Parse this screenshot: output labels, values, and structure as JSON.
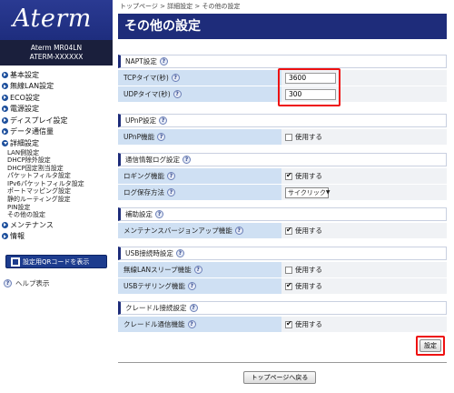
{
  "brand": {
    "logo": "Aterm",
    "model_line1": "Aterm MR04LN",
    "model_line2": "ATERM-XXXXXX"
  },
  "sidebar": {
    "menu": [
      {
        "label": "基本設定",
        "open": false
      },
      {
        "label": "無線LAN設定",
        "open": false
      },
      {
        "label": "ECO設定",
        "open": false
      },
      {
        "label": "電源設定",
        "open": false
      },
      {
        "label": "ディスプレイ設定",
        "open": false
      },
      {
        "label": "データ通信量",
        "open": false
      },
      {
        "label": "詳細設定",
        "open": true
      }
    ],
    "submenu": [
      "LAN側設定",
      "DHCP除外設定",
      "DHCP固定割当設定",
      "パケットフィルタ設定",
      "IPv6パケットフィルタ設定",
      "ポートマッピング設定",
      "静的ルーティング設定",
      "PIN設定",
      "その他の設定"
    ],
    "menu_after": [
      {
        "label": "メンテナンス",
        "open": false
      },
      {
        "label": "情報",
        "open": false
      }
    ],
    "qr_button": "設定用QRコードを表示",
    "help_link": "ヘルプ表示"
  },
  "breadcrumb": "トップページ > 詳細設定 > その他の設定",
  "page_title": "その他の設定",
  "help_glyph": "?",
  "sections": {
    "napt": {
      "title": "NAPT設定",
      "tcp_label": "TCPタイマ(秒)",
      "tcp_value": "3600",
      "udp_label": "UDPタイマ(秒)",
      "udp_value": "300"
    },
    "upnp": {
      "title": "UPnP設定",
      "label": "UPnP機能",
      "check_label": "使用する",
      "checked": false
    },
    "log": {
      "title": "通信情報ログ設定",
      "logging_label": "ロギング機能",
      "logging_check": "使用する",
      "logging_checked": true,
      "save_label": "ログ保存方法",
      "save_value": "サイクリック"
    },
    "aux": {
      "title": "補助設定",
      "label": "メンテナンスバージョンアップ機能",
      "check_label": "使用する",
      "checked": true
    },
    "usb": {
      "title": "USB接続時設定",
      "sleep_label": "無線LANスリープ機能",
      "sleep_check": "使用する",
      "sleep_checked": false,
      "tether_label": "USBテザリング機能",
      "tether_check": "使用する",
      "tether_checked": true
    },
    "cradle": {
      "title": "クレードル接続設定",
      "label": "クレードル通信機能",
      "check_label": "使用する",
      "checked": true
    }
  },
  "buttons": {
    "set": "設定",
    "home": "トップページへ戻る"
  },
  "colors": {
    "brand_blue": "#1e2c7a",
    "label_bg": "#cfe0f3",
    "highlight": "#e11111"
  }
}
